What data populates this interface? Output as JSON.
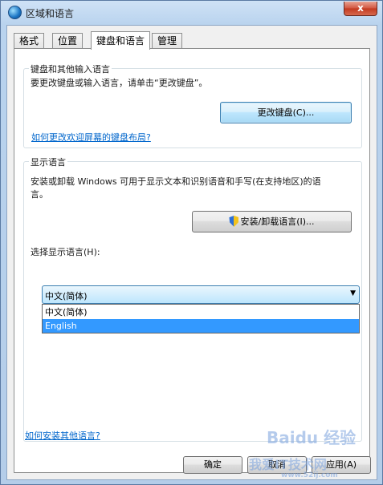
{
  "window": {
    "title": "区域和语言",
    "close_label": "x"
  },
  "tabs": [
    {
      "label": "格式"
    },
    {
      "label": "位置"
    },
    {
      "label": "键盘和语言"
    },
    {
      "label": "管理"
    }
  ],
  "keyboard_group": {
    "title": "键盘和其他输入语言",
    "description": "要更改键盘或输入语言，请单击“更改键盘”。",
    "change_button": "更改键盘(C)...",
    "link": "如何更改欢迎屏幕的键盘布局?"
  },
  "display_group": {
    "title": "显示语言",
    "description_line1": "安装或卸载 Windows 可用于显示文本和识别语音和手写(在支持地区)的语",
    "description_line2": "言。",
    "install_button": "安装/卸载语言(I)...",
    "select_label": "选择显示语言(H):",
    "selected_value": "中文(简体)",
    "options": [
      "中文(简体)",
      "English"
    ],
    "highlighted_option": "English"
  },
  "bottom_link": "如何安装其他语言?",
  "footer": {
    "ok": "确定",
    "cancel": "取消",
    "apply": "应用(A)"
  },
  "watermark": {
    "brand": "Baidu 经验",
    "site_text": "我爱IT技术网",
    "url": "www.52ij.com"
  },
  "colors": {
    "link": "#0066cc",
    "selection": "#3399ff",
    "focus_border": "#3c7fb1"
  }
}
